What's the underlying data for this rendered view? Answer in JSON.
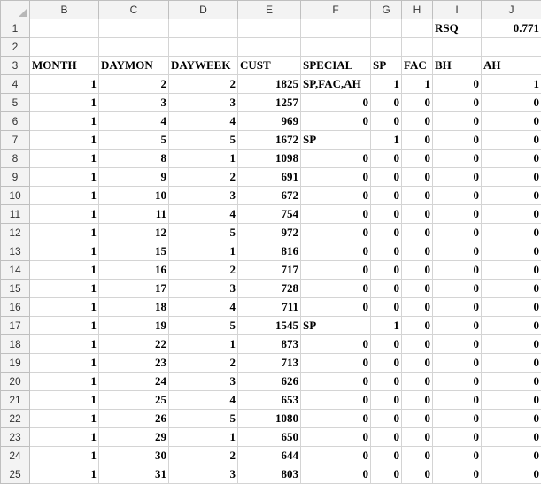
{
  "columns": [
    "B",
    "C",
    "D",
    "E",
    "F",
    "G",
    "H",
    "I",
    "J"
  ],
  "top_row": {
    "row": "1",
    "label": "RSQ",
    "value": "0.771"
  },
  "blank_row": "2",
  "header_row": {
    "row": "3",
    "cells": [
      "MONTH",
      "DAYMON",
      "DAYWEEK",
      "CUST",
      "SPECIAL",
      "SP",
      "FAC",
      "BH",
      "AH"
    ]
  },
  "rows": [
    {
      "row": "4",
      "month": "1",
      "daymon": "2",
      "dayweek": "2",
      "cust": "1825",
      "special": "SP,FAC,AH",
      "sp": "1",
      "fac": "1",
      "bh": "0",
      "ah": "1"
    },
    {
      "row": "5",
      "month": "1",
      "daymon": "3",
      "dayweek": "3",
      "cust": "1257",
      "special": "0",
      "sp": "0",
      "fac": "0",
      "bh": "0",
      "ah": "0"
    },
    {
      "row": "6",
      "month": "1",
      "daymon": "4",
      "dayweek": "4",
      "cust": "969",
      "special": "0",
      "sp": "0",
      "fac": "0",
      "bh": "0",
      "ah": "0"
    },
    {
      "row": "7",
      "month": "1",
      "daymon": "5",
      "dayweek": "5",
      "cust": "1672",
      "special": "SP",
      "sp": "1",
      "fac": "0",
      "bh": "0",
      "ah": "0"
    },
    {
      "row": "8",
      "month": "1",
      "daymon": "8",
      "dayweek": "1",
      "cust": "1098",
      "special": "0",
      "sp": "0",
      "fac": "0",
      "bh": "0",
      "ah": "0"
    },
    {
      "row": "9",
      "month": "1",
      "daymon": "9",
      "dayweek": "2",
      "cust": "691",
      "special": "0",
      "sp": "0",
      "fac": "0",
      "bh": "0",
      "ah": "0"
    },
    {
      "row": "10",
      "month": "1",
      "daymon": "10",
      "dayweek": "3",
      "cust": "672",
      "special": "0",
      "sp": "0",
      "fac": "0",
      "bh": "0",
      "ah": "0"
    },
    {
      "row": "11",
      "month": "1",
      "daymon": "11",
      "dayweek": "4",
      "cust": "754",
      "special": "0",
      "sp": "0",
      "fac": "0",
      "bh": "0",
      "ah": "0"
    },
    {
      "row": "12",
      "month": "1",
      "daymon": "12",
      "dayweek": "5",
      "cust": "972",
      "special": "0",
      "sp": "0",
      "fac": "0",
      "bh": "0",
      "ah": "0"
    },
    {
      "row": "13",
      "month": "1",
      "daymon": "15",
      "dayweek": "1",
      "cust": "816",
      "special": "0",
      "sp": "0",
      "fac": "0",
      "bh": "0",
      "ah": "0"
    },
    {
      "row": "14",
      "month": "1",
      "daymon": "16",
      "dayweek": "2",
      "cust": "717",
      "special": "0",
      "sp": "0",
      "fac": "0",
      "bh": "0",
      "ah": "0"
    },
    {
      "row": "15",
      "month": "1",
      "daymon": "17",
      "dayweek": "3",
      "cust": "728",
      "special": "0",
      "sp": "0",
      "fac": "0",
      "bh": "0",
      "ah": "0"
    },
    {
      "row": "16",
      "month": "1",
      "daymon": "18",
      "dayweek": "4",
      "cust": "711",
      "special": "0",
      "sp": "0",
      "fac": "0",
      "bh": "0",
      "ah": "0"
    },
    {
      "row": "17",
      "month": "1",
      "daymon": "19",
      "dayweek": "5",
      "cust": "1545",
      "special": "SP",
      "sp": "1",
      "fac": "0",
      "bh": "0",
      "ah": "0"
    },
    {
      "row": "18",
      "month": "1",
      "daymon": "22",
      "dayweek": "1",
      "cust": "873",
      "special": "0",
      "sp": "0",
      "fac": "0",
      "bh": "0",
      "ah": "0"
    },
    {
      "row": "19",
      "month": "1",
      "daymon": "23",
      "dayweek": "2",
      "cust": "713",
      "special": "0",
      "sp": "0",
      "fac": "0",
      "bh": "0",
      "ah": "0"
    },
    {
      "row": "20",
      "month": "1",
      "daymon": "24",
      "dayweek": "3",
      "cust": "626",
      "special": "0",
      "sp": "0",
      "fac": "0",
      "bh": "0",
      "ah": "0"
    },
    {
      "row": "21",
      "month": "1",
      "daymon": "25",
      "dayweek": "4",
      "cust": "653",
      "special": "0",
      "sp": "0",
      "fac": "0",
      "bh": "0",
      "ah": "0"
    },
    {
      "row": "22",
      "month": "1",
      "daymon": "26",
      "dayweek": "5",
      "cust": "1080",
      "special": "0",
      "sp": "0",
      "fac": "0",
      "bh": "0",
      "ah": "0"
    },
    {
      "row": "23",
      "month": "1",
      "daymon": "29",
      "dayweek": "1",
      "cust": "650",
      "special": "0",
      "sp": "0",
      "fac": "0",
      "bh": "0",
      "ah": "0"
    },
    {
      "row": "24",
      "month": "1",
      "daymon": "30",
      "dayweek": "2",
      "cust": "644",
      "special": "0",
      "sp": "0",
      "fac": "0",
      "bh": "0",
      "ah": "0"
    },
    {
      "row": "25",
      "month": "1",
      "daymon": "31",
      "dayweek": "3",
      "cust": "803",
      "special": "0",
      "sp": "0",
      "fac": "0",
      "bh": "0",
      "ah": "0"
    }
  ]
}
